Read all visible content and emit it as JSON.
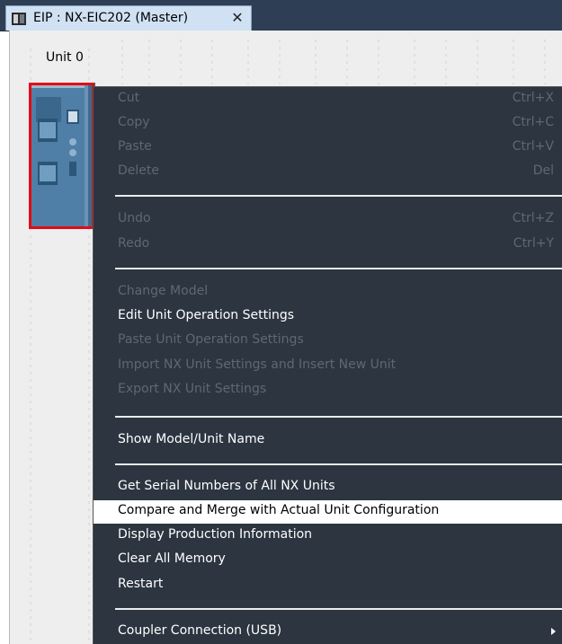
{
  "tab": {
    "title": "EIP : NX-EIC202 (Master)",
    "close_glyph": "✕",
    "icon": "device-icon"
  },
  "canvas": {
    "unit_label": "Unit 0"
  },
  "menu": {
    "items": [
      {
        "label": "Cut",
        "shortcut": "Ctrl+X",
        "enabled": false
      },
      {
        "label": "Copy",
        "shortcut": "Ctrl+C",
        "enabled": false
      },
      {
        "label": "Paste",
        "shortcut": "Ctrl+V",
        "enabled": false
      },
      {
        "label": "Delete",
        "shortcut": "Del",
        "enabled": false
      },
      {
        "label": "Undo",
        "shortcut": "Ctrl+Z",
        "enabled": false
      },
      {
        "label": "Redo",
        "shortcut": "Ctrl+Y",
        "enabled": false
      },
      {
        "label": "Change Model",
        "enabled": false
      },
      {
        "label": "Edit Unit Operation Settings",
        "enabled": true
      },
      {
        "label": "Paste Unit Operation Settings",
        "enabled": false
      },
      {
        "label": "Import NX Unit Settings and Insert New Unit",
        "enabled": false
      },
      {
        "label": "Export NX Unit Settings",
        "enabled": false
      },
      {
        "label": "Show Model/Unit Name",
        "enabled": true
      },
      {
        "label": "Get Serial Numbers of All NX Units",
        "enabled": true
      },
      {
        "label": "Compare and Merge with Actual Unit Configuration",
        "enabled": true,
        "highlighted": true
      },
      {
        "label": "Display Production Information",
        "enabled": true
      },
      {
        "label": "Clear All Memory",
        "enabled": true
      },
      {
        "label": "Restart",
        "enabled": true
      },
      {
        "label": "Coupler Connection (USB)",
        "enabled": true,
        "has_submenu": true
      }
    ]
  },
  "colors": {
    "menu_bg": "#2c3540",
    "disabled_text": "#5f6872",
    "highlight_border": "#e30b17",
    "tab_bg": "#cfe1f3"
  }
}
